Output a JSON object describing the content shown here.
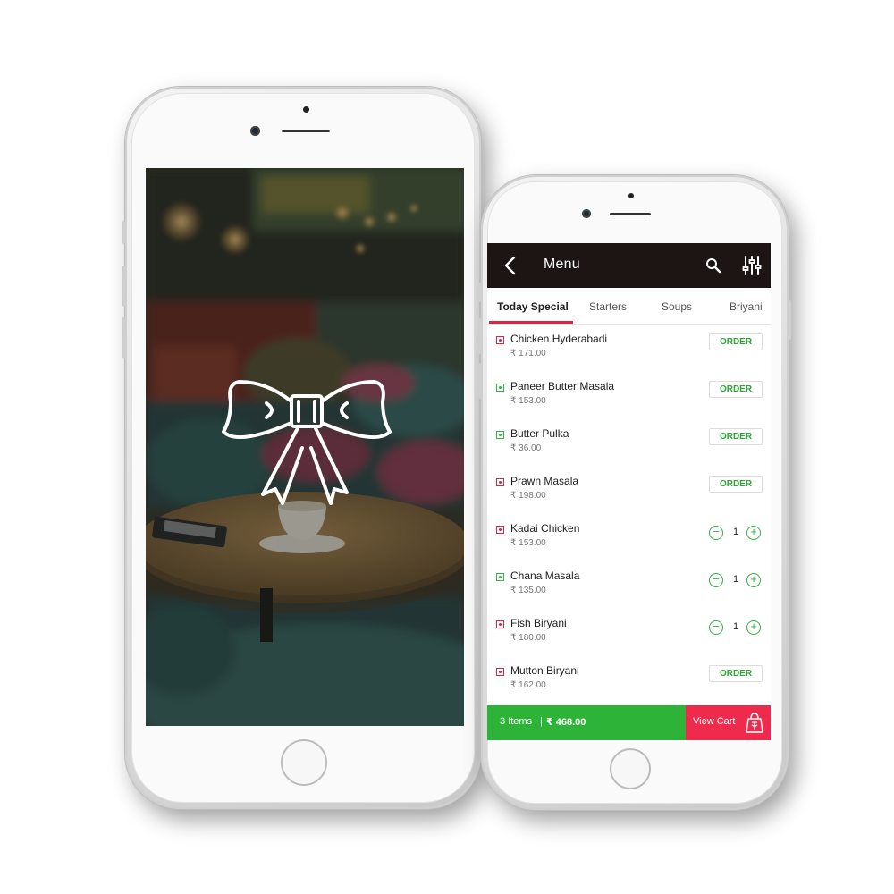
{
  "colors": {
    "appbar_bg": "#1d1414",
    "tab_indicator": "#e8213b",
    "order_text": "#2ea436",
    "stepper_green": "#2fb342",
    "cart_bar_green": "#2db337",
    "view_cart_red": "#ee2b4c",
    "veg_mark": "#2fb342",
    "nonveg_mark": "#e8213b"
  },
  "splash": {
    "logo_icon": "bow-icon"
  },
  "header": {
    "title": "Menu",
    "back_icon": "back-arrow-icon",
    "search_icon": "search-icon",
    "filter_icon": "filter-icon"
  },
  "tabs": [
    {
      "label": "Today Special",
      "active": true
    },
    {
      "label": "Starters",
      "active": false
    },
    {
      "label": "Soups",
      "active": false
    },
    {
      "label": "Briyani",
      "active": false
    }
  ],
  "menu_items": [
    {
      "name": "Chicken Hyderabadi",
      "price": "₹ 171.00",
      "veg": false,
      "action": "order",
      "order_label": "ORDER"
    },
    {
      "name": "Paneer Butter Masala",
      "price": "₹ 153.00",
      "veg": true,
      "action": "order",
      "order_label": "ORDER"
    },
    {
      "name": "Butter Pulka",
      "price": "₹ 36.00",
      "veg": true,
      "action": "order",
      "order_label": "ORDER"
    },
    {
      "name": "Prawn Masala",
      "price": "₹ 198.00",
      "veg": false,
      "action": "order",
      "order_label": "ORDER"
    },
    {
      "name": "Kadai Chicken",
      "price": "₹ 153.00",
      "veg": false,
      "action": "stepper",
      "quantity": "1"
    },
    {
      "name": "Chana Masala",
      "price": "₹ 135.00",
      "veg": true,
      "action": "stepper",
      "quantity": "1"
    },
    {
      "name": "Fish Biryani",
      "price": "₹ 180.00",
      "veg": false,
      "action": "stepper",
      "quantity": "1"
    },
    {
      "name": "Mutton Biryani",
      "price": "₹ 162.00",
      "veg": false,
      "action": "order",
      "order_label": "ORDER"
    }
  ],
  "cart": {
    "items_label": "3 Items",
    "separator": "|",
    "total": "₹ 468.00",
    "view_cart_label": "View Cart",
    "bag_icon": "shopping-bag-icon"
  }
}
